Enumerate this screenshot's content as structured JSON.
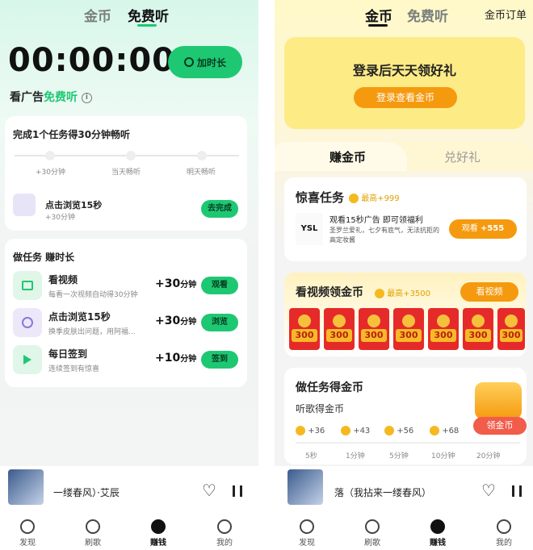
{
  "left": {
    "tabs": [
      "金币",
      "免费听"
    ],
    "timer": "00:00:00",
    "add_time_btn": "加时长",
    "ad_listen_prefix": "看广告",
    "ad_listen_suffix": "免费听",
    "task_card": {
      "title": "完成1个任务得30分钟畅听",
      "steps": [
        "+30分钟",
        "当天畅听",
        "明天畅听"
      ],
      "item_title": "点击浏览15秒",
      "item_sub": "+30分钟",
      "item_btn": "去完成"
    },
    "tasks_card": {
      "title": "做任务 赚时长",
      "items": [
        {
          "title": "看视频",
          "sub": "每看一次视频自动得30分钟",
          "reward": "+30",
          "unit": "分钟",
          "btn": "观看",
          "icon": "calendar-icon"
        },
        {
          "title": "点击浏览15秒",
          "sub": "换季皮肤出问题，用阿福...",
          "reward": "+30",
          "unit": "分钟",
          "btn": "浏览",
          "icon": "browse-icon"
        },
        {
          "title": "每日签到",
          "sub": "连续签到有惊喜",
          "reward": "+10",
          "unit": "分钟",
          "btn": "签到",
          "icon": "play-icon"
        }
      ]
    },
    "player": {
      "song": "一缕春风）·艾辰"
    },
    "nav": [
      "发现",
      "刷歌",
      "赚钱",
      "我的"
    ]
  },
  "right": {
    "tabs": [
      "金币",
      "免费听"
    ],
    "orders": "金币订单",
    "login_banner": {
      "title": "登录后天天领好礼",
      "btn": "登录查看金币"
    },
    "subtabs": [
      "赚金币",
      "兑好礼"
    ],
    "surprise": {
      "title": "惊喜任务",
      "badge": "最高+999",
      "line1": "观看15秒广告 即可领福利",
      "line2": "圣罗兰爱礼，七夕有底气，无法抗拒的高定妆酱",
      "btn": "观看",
      "btn_value": "+555"
    },
    "video_coins": {
      "title": "看视频领金币",
      "badge": "最高+3500",
      "btn": "看视频",
      "envelopes": [
        "300",
        "300",
        "300",
        "300",
        "300",
        "300",
        "300"
      ]
    },
    "task_coins": {
      "title": "做任务得金币",
      "subtitle": "听歌得金币",
      "rewards": [
        "+36",
        "+43",
        "+56",
        "+68"
      ],
      "times": [
        "5秒",
        "1分钟",
        "5分钟",
        "10分钟",
        "20分钟"
      ],
      "float_label": "领金币"
    },
    "player": {
      "song": "落（我拈来一缕春风）"
    },
    "nav": [
      "发现",
      "刷歌",
      "赚钱",
      "我的"
    ]
  }
}
